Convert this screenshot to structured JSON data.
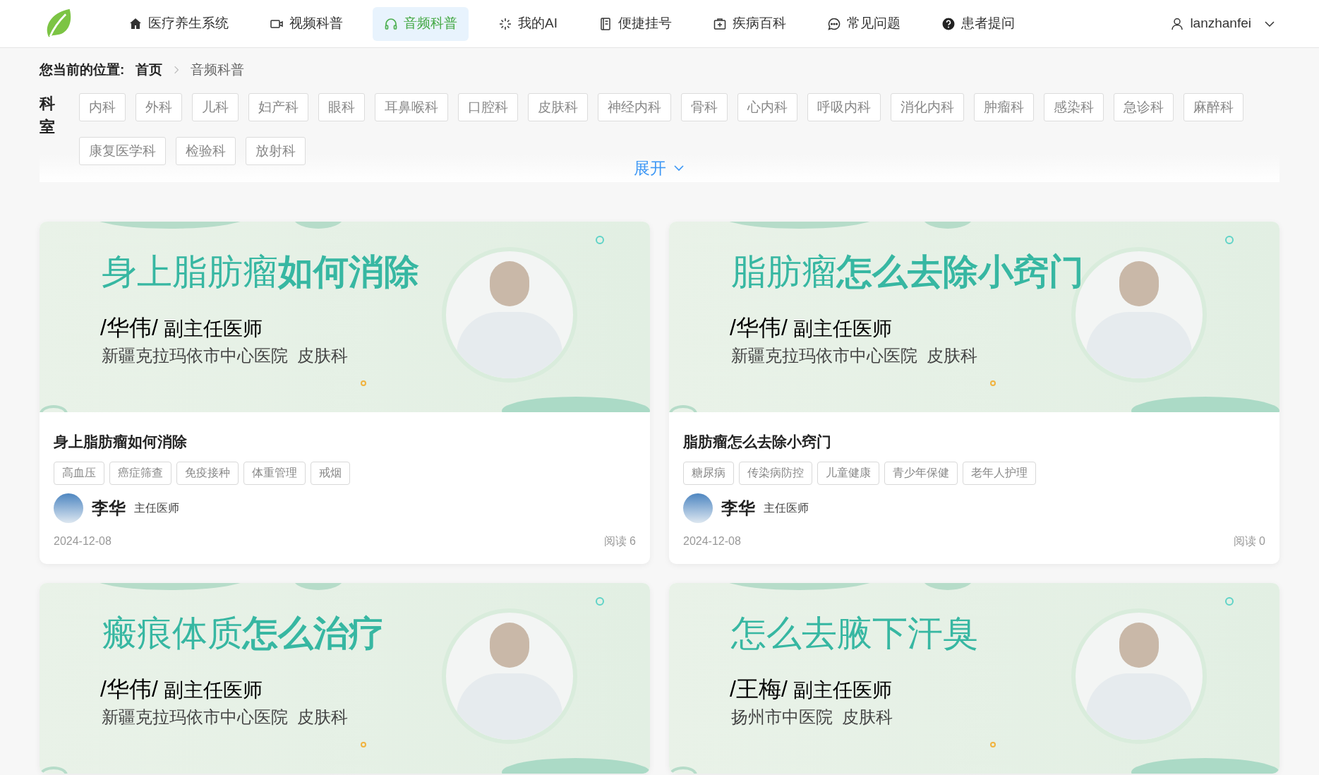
{
  "nav": {
    "items": [
      {
        "label": "医疗养生系统",
        "selected": false
      },
      {
        "label": "视频科普",
        "selected": false
      },
      {
        "label": "音频科普",
        "selected": true
      },
      {
        "label": "我的AI",
        "selected": false
      },
      {
        "label": "便捷挂号",
        "selected": false
      },
      {
        "label": "疾病百科",
        "selected": false
      },
      {
        "label": "常见问题",
        "selected": false
      },
      {
        "label": "患者提问",
        "selected": false
      }
    ],
    "user": "lanzhanfei"
  },
  "breadcrumb": {
    "label": "您当前的位置:",
    "items": [
      "首页",
      "音频科普"
    ]
  },
  "departments": {
    "label": "科室",
    "items": [
      "内科",
      "外科",
      "儿科",
      "妇产科",
      "眼科",
      "耳鼻喉科",
      "口腔科",
      "皮肤科",
      "神经内科",
      "骨科",
      "心内科",
      "呼吸内科",
      "消化内科",
      "肿瘤科",
      "感染科",
      "急诊科",
      "麻醉科",
      "康复医学科",
      "检验科",
      "放射科"
    ],
    "expand": "展开"
  },
  "cards": [
    {
      "cover_title": "身上脂肪瘤**如何消除**",
      "cover_doctor": "/华伟/",
      "cover_doctor_title": "副主任医师",
      "cover_hospital": "新疆克拉玛依市中心医院  皮肤科",
      "title": "身上脂肪瘤如何消除",
      "tags": [
        "高血压",
        "癌症筛查",
        "免疫接种",
        "体重管理",
        "戒烟"
      ],
      "author": "李华",
      "author_title": "主任医师",
      "date": "2024-12-08",
      "reads": "阅读 6"
    },
    {
      "cover_title": "脂肪瘤**怎么去除小窍门**",
      "cover_doctor": "/华伟/",
      "cover_doctor_title": "副主任医师",
      "cover_hospital": "新疆克拉玛依市中心医院  皮肤科",
      "title": "脂肪瘤怎么去除小窍门",
      "tags": [
        "糖尿病",
        "传染病防控",
        "儿童健康",
        "青少年保健",
        "老年人护理"
      ],
      "author": "李华",
      "author_title": "主任医师",
      "date": "2024-12-08",
      "reads": "阅读 0"
    },
    {
      "cover_title": "瘢痕体质**怎么治疗**",
      "cover_doctor": "/华伟/",
      "cover_doctor_title": "副主任医师",
      "cover_hospital": "新疆克拉玛依市中心医院  皮肤科"
    },
    {
      "cover_title": "怎么去腋下汗臭",
      "cover_doctor": "/王梅/",
      "cover_doctor_title": "副主任医师",
      "cover_hospital": "扬州市中医院  皮肤科"
    }
  ]
}
